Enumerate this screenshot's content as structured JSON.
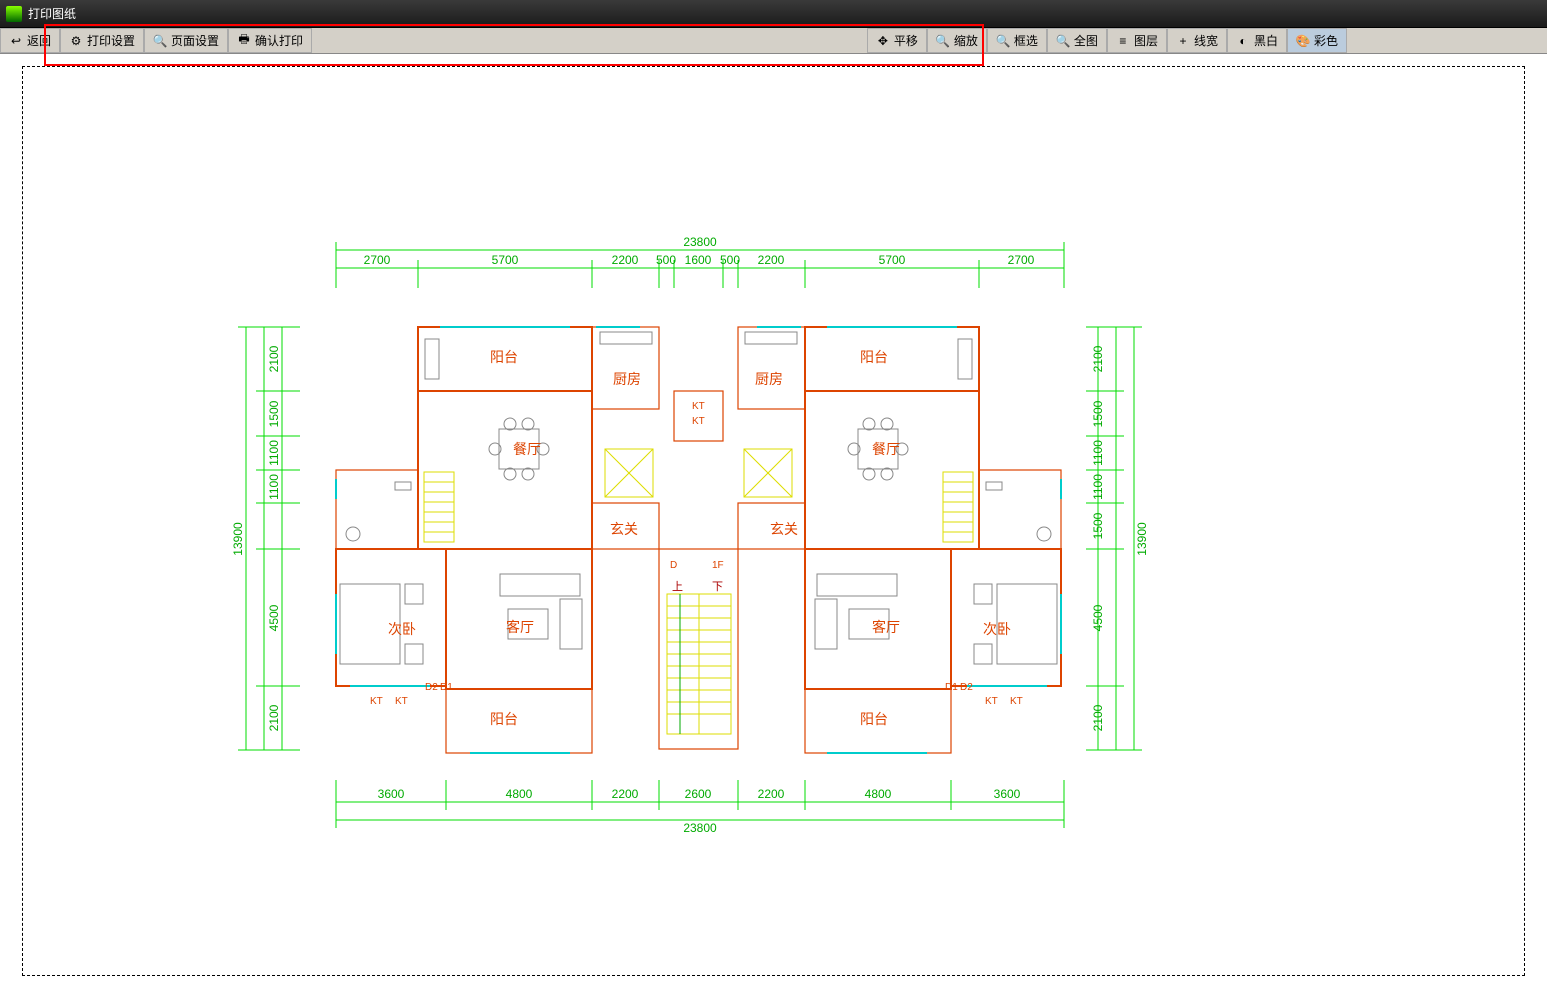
{
  "title": "打印图纸",
  "toolbar_left": {
    "back": "返回",
    "print_settings": "打印设置",
    "page_settings": "页面设置",
    "confirm_print": "确认打印"
  },
  "toolbar_right": {
    "pan": "平移",
    "zoom": "缩放",
    "select_box": "框选",
    "fit_all": "全图",
    "layers": "图层",
    "lineweight": "线宽",
    "blackwhite": "黑白",
    "color": "彩色"
  },
  "dims_top_total": "23800",
  "dims_top": [
    "2700",
    "5700",
    "2200",
    "500",
    "1600",
    "500",
    "2200",
    "5700",
    "2700"
  ],
  "dims_left_total": "13900",
  "dims_left": [
    "2100",
    "1500",
    "1100",
    "1100",
    "4500",
    "2100"
  ],
  "dims_right_total": "13900",
  "dims_right": [
    "2100",
    "1500",
    "1100",
    "1100",
    "1500",
    "4500",
    "2100"
  ],
  "dims_bottom_total": "23800",
  "dims_bottom": [
    "3600",
    "4800",
    "2200",
    "2600",
    "2200",
    "4800",
    "3600"
  ],
  "rooms": {
    "balcony": "阳台",
    "kitchen": "厨房",
    "dining": "餐厅",
    "entrance": "玄关",
    "living": "客厅",
    "bedroom2": "次卧"
  },
  "markers": {
    "up": "上",
    "down": "下",
    "d": "D",
    "f": "1F",
    "d1": "D1",
    "d2": "D2",
    "kt": "KT"
  }
}
